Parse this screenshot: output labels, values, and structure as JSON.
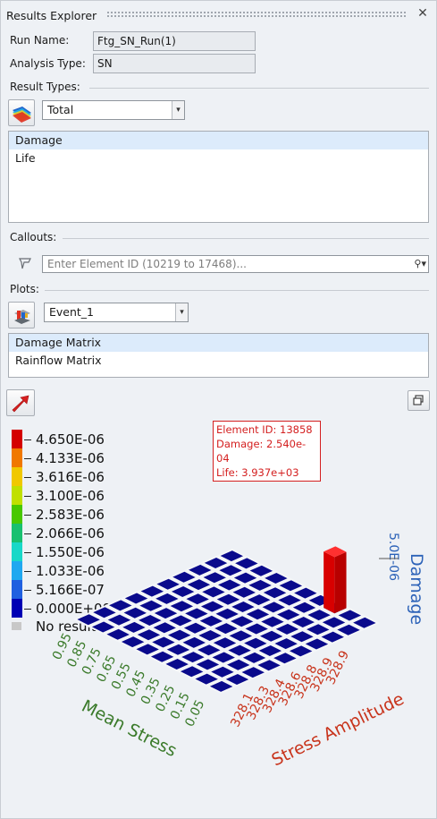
{
  "window": {
    "title": "Results Explorer"
  },
  "run": {
    "run_name_label": "Run Name:",
    "run_name_value": "Ftg_SN_Run(1)",
    "analysis_type_label": "Analysis Type:",
    "analysis_type_value": "SN"
  },
  "result_types": {
    "section_label": "Result Types:",
    "combo_value": "Total",
    "items": [
      {
        "label": "Damage",
        "selected": true
      },
      {
        "label": "Life",
        "selected": false
      }
    ]
  },
  "callouts": {
    "section_label": "Callouts:",
    "search_placeholder": "Enter Element ID (10219 to 17468)..."
  },
  "plots": {
    "section_label": "Plots:",
    "combo_value": "Event_1",
    "items": [
      {
        "label": "Damage Matrix",
        "selected": true
      },
      {
        "label": "Rainflow Matrix",
        "selected": false
      }
    ]
  },
  "legend": {
    "values": [
      "4.650E-06",
      "4.133E-06",
      "3.616E-06",
      "3.100E-06",
      "2.583E-06",
      "2.066E-06",
      "1.550E-06",
      "1.033E-06",
      "5.166E-07",
      "0.000E+00"
    ],
    "colors": [
      "#d40000",
      "#f07800",
      "#f0c800",
      "#c0e000",
      "#48c800",
      "#18c070",
      "#18d8c8",
      "#20a8f0",
      "#2060e0",
      "#0000b4"
    ],
    "no_result_label": "No result",
    "no_result_color": "#c8c8c8"
  },
  "probe": {
    "element_id": "Element ID: 13858",
    "damage": "Damage: 2.540e-04",
    "life": "Life: 3.937e+03"
  },
  "chart_data": {
    "type": "heatmap",
    "title": "",
    "xlabel": "Mean Stress",
    "ylabel": "Stress Amplitude",
    "zlabel": "Damage",
    "z_tick": "5.0E-06",
    "mean_stress_ticks": [
      "0.95",
      "0.85",
      "0.75",
      "0.65",
      "0.55",
      "0.45",
      "0.35",
      "0.25",
      "0.15",
      "0.05"
    ],
    "stress_amplitude_ticks": [
      "328.1",
      "328.3",
      "328.4",
      "328.6",
      "328.8",
      "328.9",
      "328.9"
    ],
    "tall_bar": {
      "mean_stress": "0.95",
      "stress_amplitude": "328.9",
      "damage": 0.000254
    },
    "cell_color": "#0a0a8c",
    "bar_color": "#d80000",
    "mean_stress_color": "#3a7a2a",
    "amplitude_color": "#c8341c",
    "damage_color": "#2c62b8"
  }
}
